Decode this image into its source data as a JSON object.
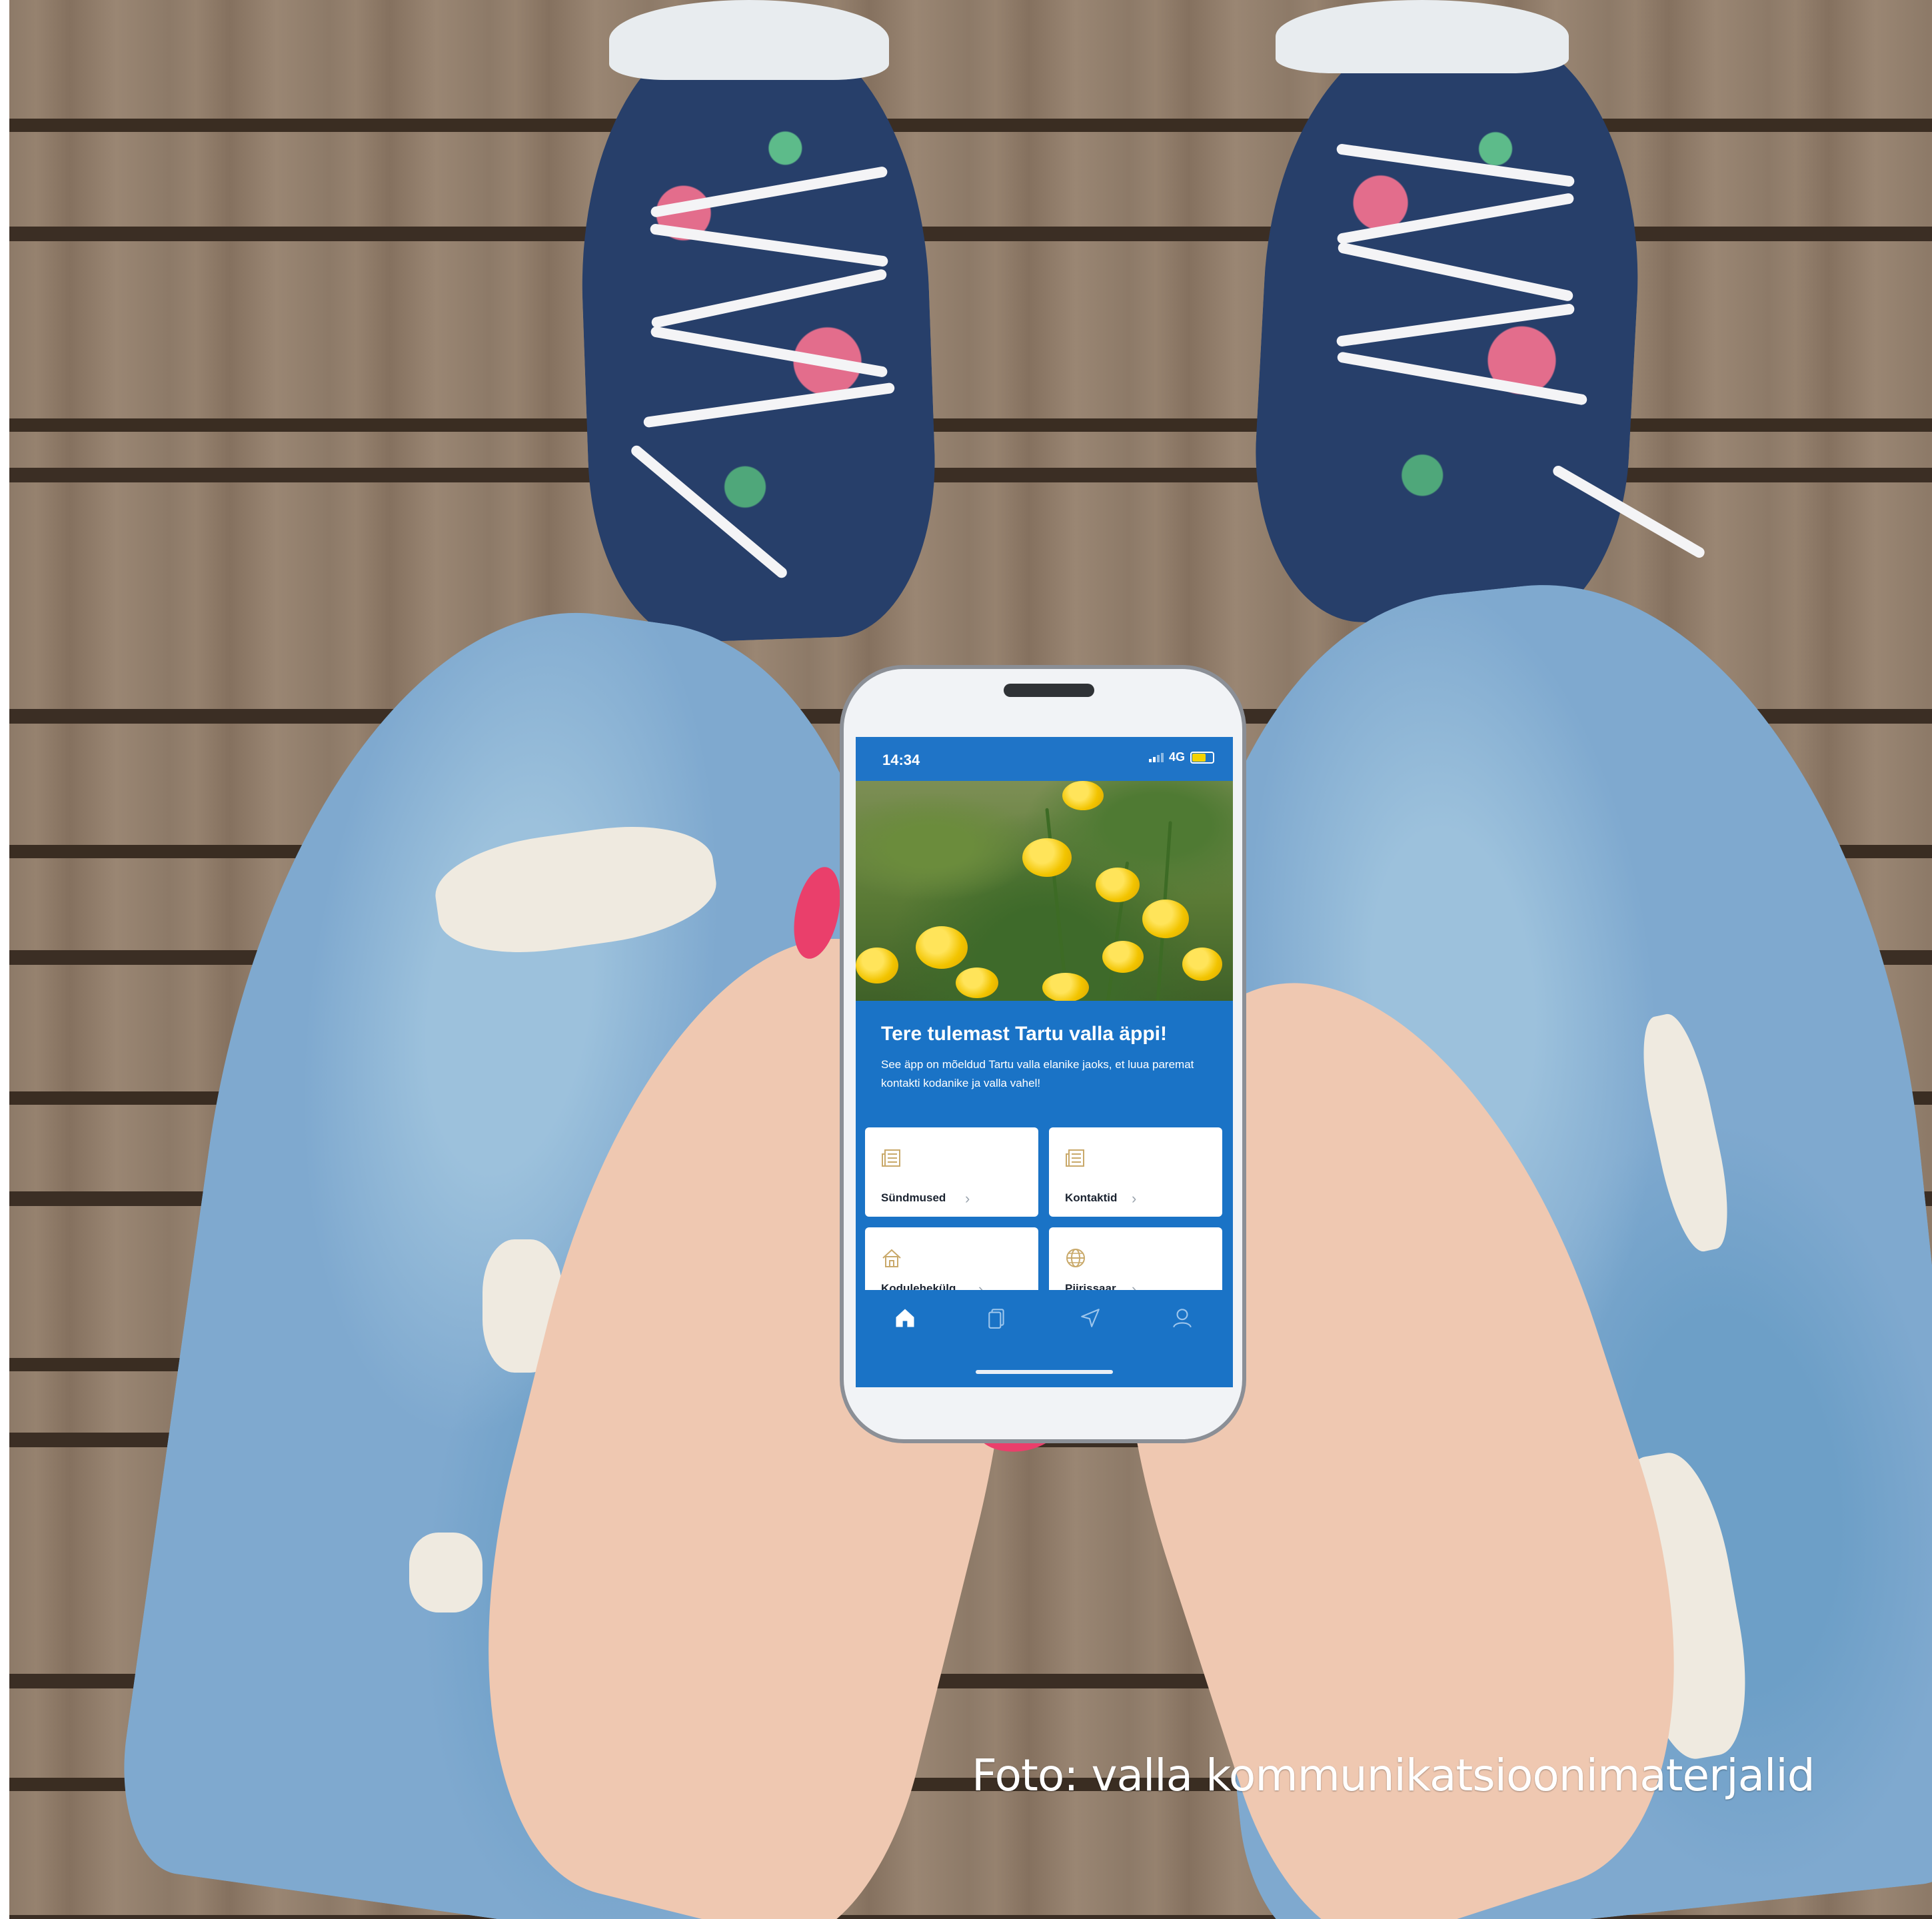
{
  "status_bar": {
    "time": "14:34",
    "network": "4G",
    "battery_level": 0.7
  },
  "welcome": {
    "title": "Tere tulemast Tartu valla äppi!",
    "text": "See äpp on mõeldud Tartu valla elanike jaoks, et luua paremat kontakti kodanike ja valla vahel!"
  },
  "cards": [
    {
      "label": "Sündmused",
      "icon": "newspaper-icon"
    },
    {
      "label": "Kontaktid",
      "icon": "newspaper-icon"
    },
    {
      "label": "Kodulehekülg",
      "icon": "house-icon"
    },
    {
      "label": "Piirissaar",
      "icon": "globe-icon"
    }
  ],
  "tab_bar": {
    "items": [
      {
        "icon": "home-icon",
        "active": true
      },
      {
        "icon": "documents-icon",
        "active": false
      },
      {
        "icon": "location-arrow-icon",
        "active": false
      },
      {
        "icon": "profile-icon",
        "active": false
      }
    ]
  },
  "caption": "Foto: valla kommunikatsioonimaterjalid",
  "colors": {
    "app_blue": "#1a73c6",
    "card_icon_gold": "#c9a96a",
    "nail_pink": "#ea3f6b"
  }
}
